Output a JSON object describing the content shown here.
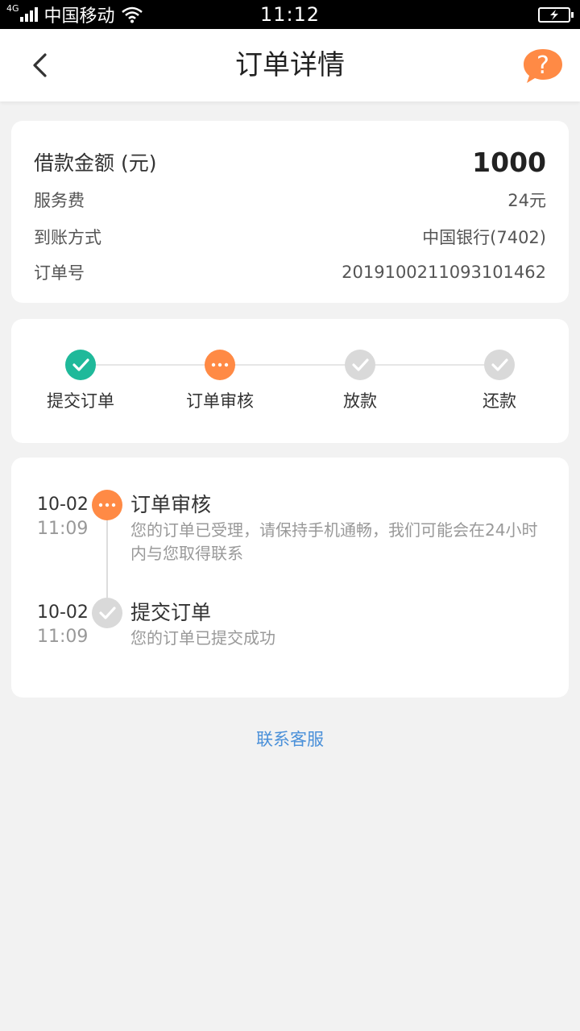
{
  "status_bar": {
    "network": "4G",
    "carrier": "中国移动",
    "time": "11:12"
  },
  "nav": {
    "title": "订单详情",
    "help_symbol": "?"
  },
  "order_info": {
    "amount_label": "借款金额 (元)",
    "amount_value": "1000",
    "fee_label": "服务费",
    "fee_value": "24元",
    "method_label": "到账方式",
    "method_value": "中国银行(7402)",
    "order_no_label": "订单号",
    "order_no_value": "201910021109310146​2"
  },
  "steps": [
    {
      "label": "提交订单",
      "status": "done"
    },
    {
      "label": "订单审核",
      "status": "active"
    },
    {
      "label": "放款",
      "status": "pending"
    },
    {
      "label": "还款",
      "status": "pending"
    }
  ],
  "timeline": [
    {
      "date": "10-02",
      "time": "11:09",
      "title": "订单审核",
      "desc": "您的订单已受理，请保持手机通畅，我们可能会在24小时内与您取得联系",
      "status": "active"
    },
    {
      "date": "10-02",
      "time": "11:09",
      "title": "提交订单",
      "desc": "您的订单已提交成功",
      "status": "done"
    }
  ],
  "contact_label": "联系客服",
  "colors": {
    "done": "#1fb99a",
    "active": "#ff8a45",
    "pending": "#d9d9d9",
    "link": "#4a90d9"
  }
}
